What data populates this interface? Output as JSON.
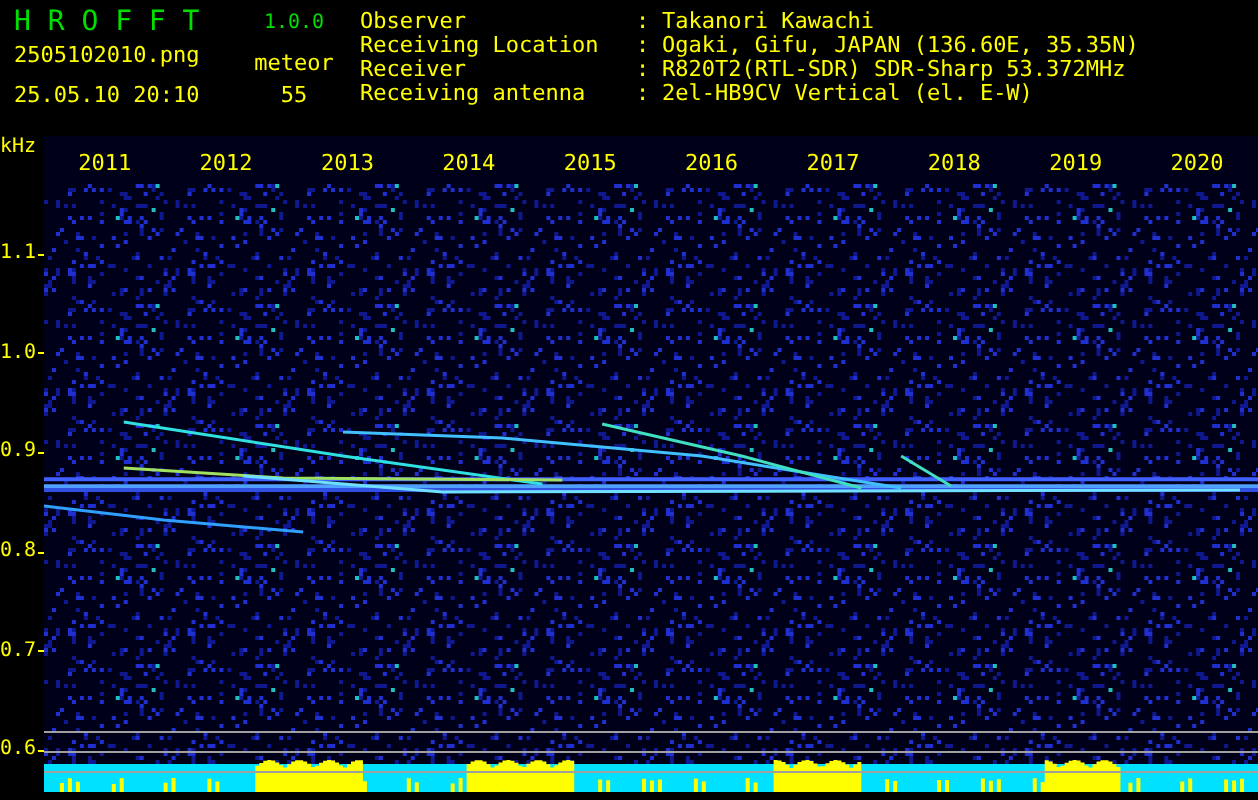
{
  "app": {
    "title": "H R O F F T",
    "version": "1.0.0"
  },
  "file": "2505102010.png",
  "datetime": "25.05.10 20:10",
  "count_label": "meteor",
  "count": "55",
  "info": [
    {
      "label": "Observer",
      "colon": ":",
      "value": "Takanori Kawachi"
    },
    {
      "label": "Receiving Location",
      "colon": ":",
      "value": "Ogaki, Gifu, JAPAN (136.60E, 35.35N)"
    },
    {
      "label": "Receiver",
      "colon": ":",
      "value": "R820T2(RTL-SDR) SDR-Sharp 53.372MHz"
    },
    {
      "label": "Receiving antenna",
      "colon": ":",
      "value": "2el-HB9CV Vertical (el. E-W)"
    }
  ],
  "spectrogram": {
    "unit": "kHz",
    "y_labels": [
      "1.1",
      "1.0",
      "0.9",
      "0.8",
      "0.7",
      "0.6"
    ],
    "x_labels": [
      "2011",
      "2012",
      "2013",
      "2014",
      "2015",
      "2016",
      "2017",
      "2018",
      "2019",
      "2020"
    ]
  }
}
